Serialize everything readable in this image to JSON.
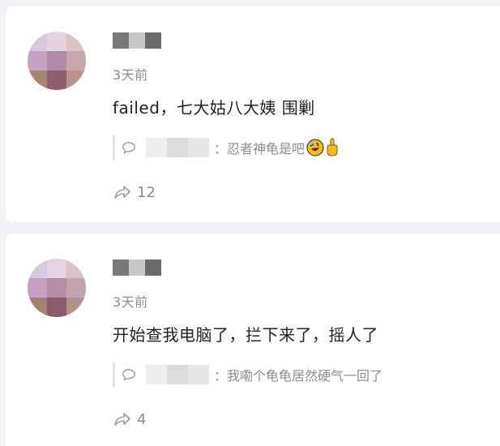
{
  "posts": [
    {
      "time": "3天前",
      "content": "failed，七大姑八大姨 围剿",
      "reply": {
        "text": "：忍者神龟是吧"
      },
      "share_count": "12",
      "avatar_colors": [
        "#d9c8dc",
        "#e6d3e0",
        "#d8c4c4",
        "#c9a0c1",
        "#b58aa6",
        "#c6a7ae",
        "#a88478",
        "#8e5e6e",
        "#b6948e"
      ],
      "name_colors": [
        "#7a7a7a",
        "#c8c8c8",
        "#6b6b6b"
      ],
      "reply_name_colors": [
        "#eeeeee",
        "#dcdcdc",
        "#e6e6e6"
      ]
    },
    {
      "time": "3天前",
      "content": "开始查我电脑了，拦下来了，摇人了",
      "reply": {
        "text": "：我嘞个龟龟居然硬气一回了"
      },
      "share_count": "4",
      "avatar_colors": [
        "#d7c9de",
        "#e5d2e2",
        "#d9c3c6",
        "#c79fc2",
        "#b78ca7",
        "#c3a3ae",
        "#a48272",
        "#8c5b6c",
        "#b4928c"
      ],
      "name_colors": [
        "#7a7a7a",
        "#c8c8c8",
        "#6b6b6b"
      ],
      "reply_name_colors": [
        "#eeeeee",
        "#dcdcdc",
        "#e6e6e6"
      ]
    }
  ],
  "icons": {
    "comment": "comment-bubble-icon",
    "share": "share-arrow-icon",
    "laugh_emoji": "rolling-laughing-emoji",
    "finger_emoji": "middle-finger-emoji"
  }
}
